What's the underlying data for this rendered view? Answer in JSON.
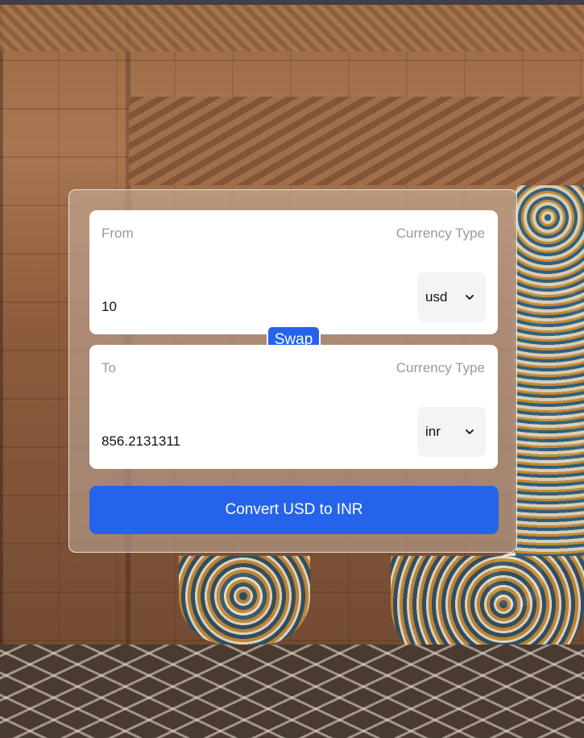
{
  "from_box": {
    "label": "From",
    "currency_label": "Currency Type",
    "amount_value": "10",
    "currency_selected": "usd"
  },
  "to_box": {
    "label": "To",
    "currency_label": "Currency Type",
    "amount_value": "856.2131311",
    "currency_selected": "inr"
  },
  "swap_label": "Swap",
  "convert_label": "Convert USD to INR",
  "colors": {
    "accent": "#2563eb",
    "select_bg": "#f3f4f6",
    "label_text": "#9a9a9a"
  },
  "icons": {
    "select_chevron": "chevron-down-icon"
  }
}
